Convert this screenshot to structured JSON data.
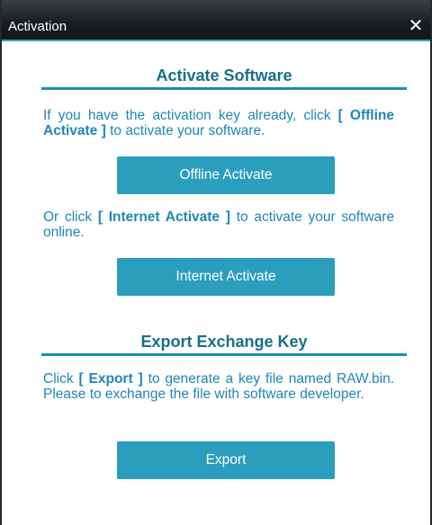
{
  "window": {
    "title": "Activation",
    "close_glyph": "✕"
  },
  "activate": {
    "heading": "Activate Software",
    "para1_text1": "If you have the activation key already, click ",
    "para1_bold": "[ Offline Activate ]",
    "para1_text2": " to activate your software.",
    "offline_button": "Offline Activate",
    "para2_text1": "Or click ",
    "para2_bold": "[ Internet Activate ]",
    "para2_text2": " to activate your software online.",
    "internet_button": "Internet Activate"
  },
  "export": {
    "heading": "Export Exchange Key",
    "para_text1": "Click ",
    "para_bold": "[ Export ]",
    "para_text2": " to generate a key file named RAW.bin. Please to exchange the file with software developer.",
    "export_button": "Export"
  },
  "colors": {
    "accent": "#2b9dbd",
    "heading": "#1a6e8c",
    "body_text": "#1f86b8",
    "titlebar": "#1b1e21"
  },
  "icons": {
    "close": "close-icon"
  }
}
